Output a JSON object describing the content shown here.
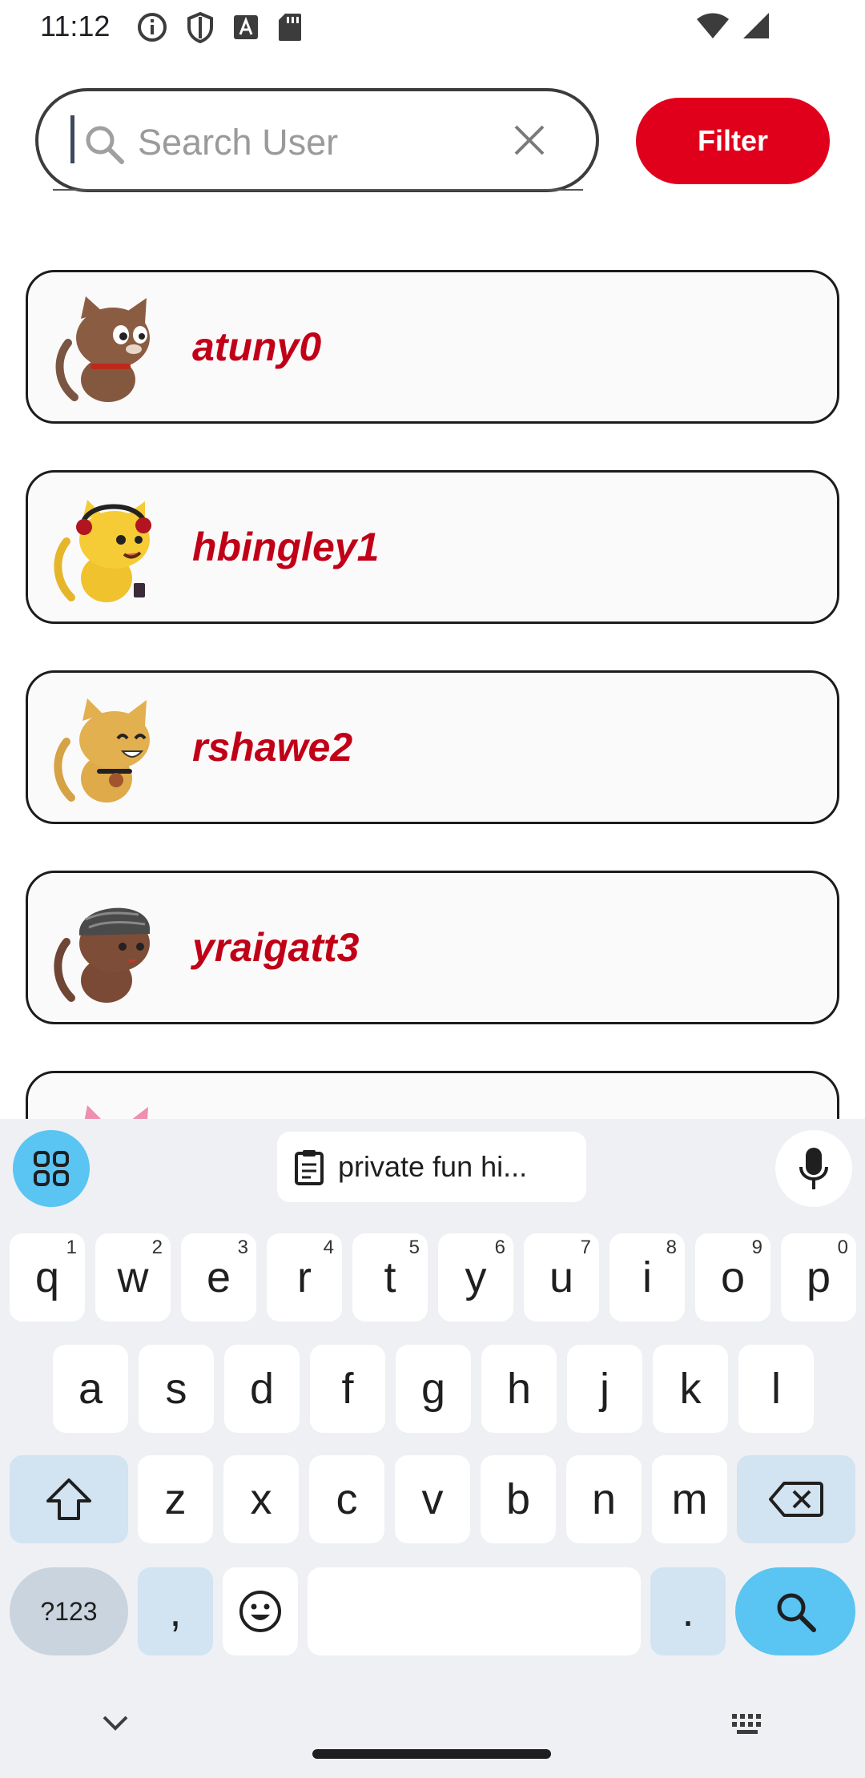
{
  "status_bar": {
    "time": "11:12",
    "left_icons": [
      "info-icon",
      "shield-icon",
      "font-icon",
      "sd-card-icon"
    ],
    "right_icons": [
      "wifi-icon",
      "cell-signal-icon"
    ]
  },
  "search": {
    "placeholder": "Search User",
    "value": "",
    "filter_label": "Filter"
  },
  "users": [
    {
      "name": "atuny0",
      "avatar": "brown-cat-collar-avatar"
    },
    {
      "name": "hbingley1",
      "avatar": "yellow-cat-headphones-avatar"
    },
    {
      "name": "rshawe2",
      "avatar": "orange-cat-bell-avatar"
    },
    {
      "name": "yraigatt3",
      "avatar": "brown-cat-bandana-avatar"
    },
    {
      "name": "",
      "avatar": "pink-cat-avatar"
    }
  ],
  "keyboard": {
    "clipboard_suggestion": "private fun hi...",
    "row1": [
      {
        "k": "q",
        "h": "1"
      },
      {
        "k": "w",
        "h": "2"
      },
      {
        "k": "e",
        "h": "3"
      },
      {
        "k": "r",
        "h": "4"
      },
      {
        "k": "t",
        "h": "5"
      },
      {
        "k": "y",
        "h": "6"
      },
      {
        "k": "u",
        "h": "7"
      },
      {
        "k": "i",
        "h": "8"
      },
      {
        "k": "o",
        "h": "9"
      },
      {
        "k": "p",
        "h": "0"
      }
    ],
    "row2": [
      "a",
      "s",
      "d",
      "f",
      "g",
      "h",
      "j",
      "k",
      "l"
    ],
    "row3": [
      "z",
      "x",
      "c",
      "v",
      "b",
      "n",
      "m"
    ],
    "symbols_label": "?123",
    "comma": ",",
    "period": "."
  },
  "colors": {
    "accent_red": "#e0001b",
    "username_red": "#c10018",
    "keyboard_blue": "#5ac4f2"
  }
}
